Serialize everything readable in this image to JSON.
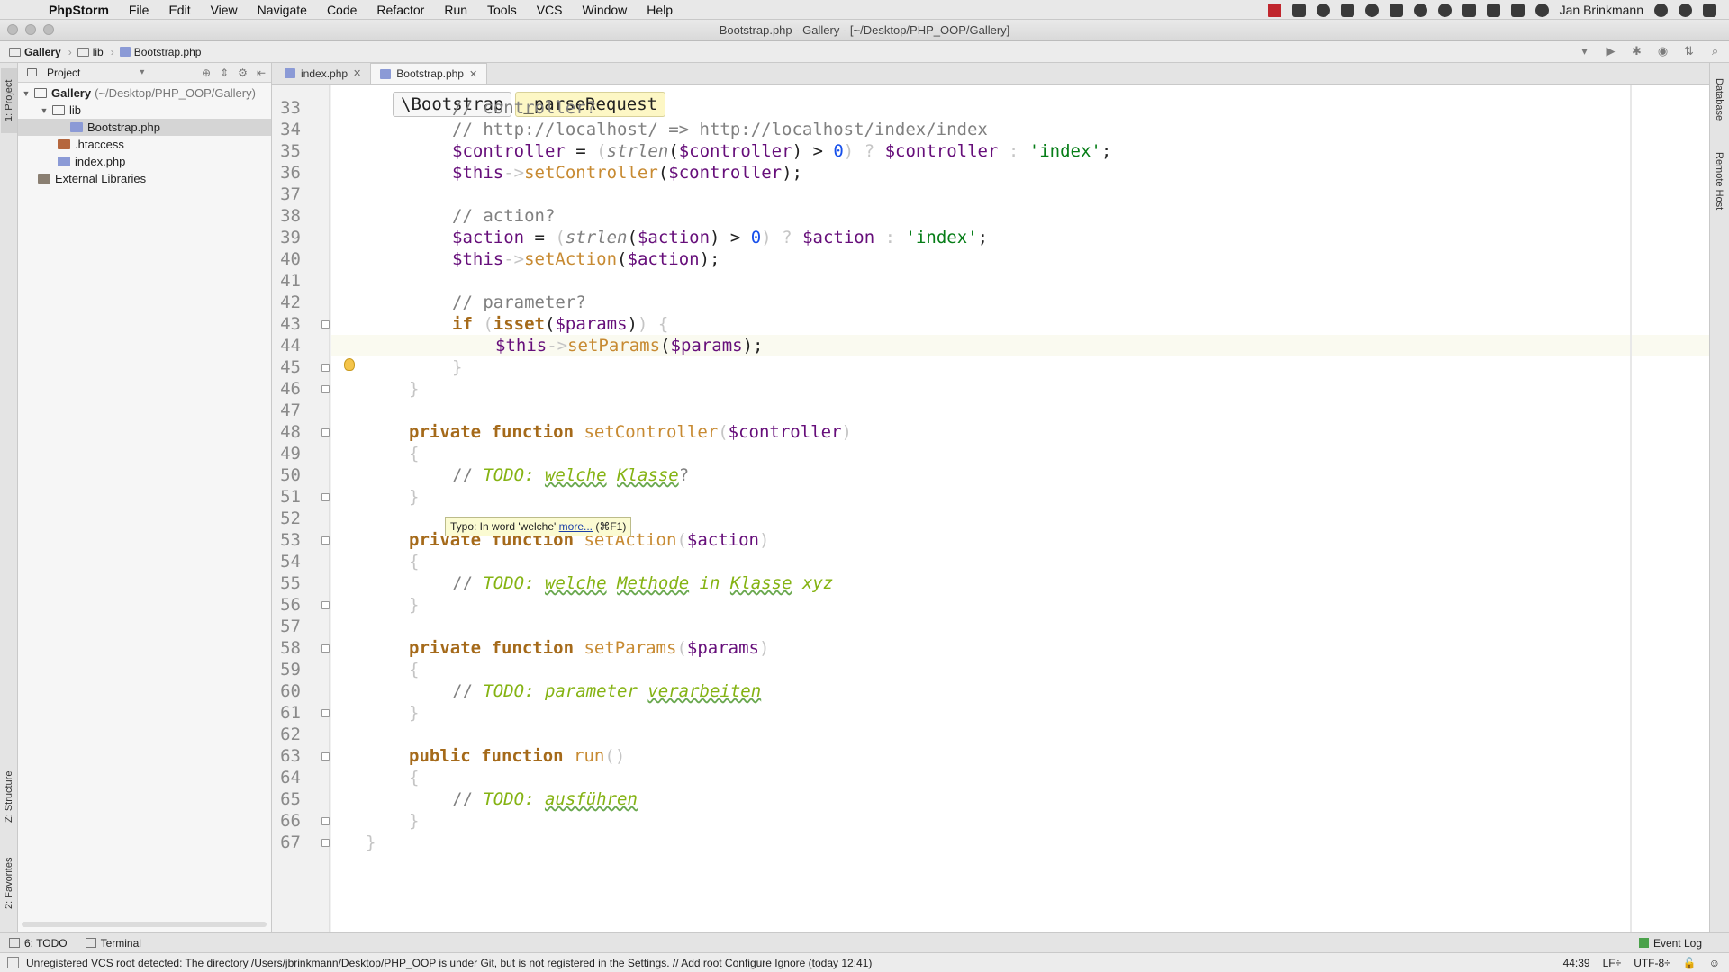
{
  "menubar": {
    "items": [
      "PhpStorm",
      "File",
      "Edit",
      "View",
      "Navigate",
      "Code",
      "Refactor",
      "Run",
      "Tools",
      "VCS",
      "Window",
      "Help"
    ],
    "user": "Jan Brinkmann"
  },
  "window": {
    "title": "Bootstrap.php - Gallery - [~/Desktop/PHP_OOP/Gallery]"
  },
  "navbar": {
    "crumbs": [
      "Gallery",
      "lib",
      "Bootstrap.php"
    ]
  },
  "project": {
    "header": "Project",
    "tree": [
      {
        "label": "Gallery",
        "path": "(~/Desktop/PHP_OOP/Gallery)",
        "type": "folder",
        "depth": 0,
        "expanded": true
      },
      {
        "label": "lib",
        "type": "folder",
        "depth": 1,
        "expanded": true
      },
      {
        "label": "Bootstrap.php",
        "type": "php",
        "depth": 2,
        "selected": true
      },
      {
        "label": ".htaccess",
        "type": "htaccess",
        "depth": 1
      },
      {
        "label": "index.php",
        "type": "php",
        "depth": 1
      },
      {
        "label": "External Libraries",
        "type": "lib",
        "depth": 0
      }
    ]
  },
  "side_tabs": {
    "project": "1: Project",
    "structure": "Z: Structure",
    "favorites": "2: Favorites",
    "database": "Database",
    "remote": "Remote Host"
  },
  "tabs": [
    {
      "label": "index.php",
      "active": false
    },
    {
      "label": "Bootstrap.php",
      "active": true
    }
  ],
  "editor": {
    "breadcrumb": [
      "\\Bootstrap",
      "_parseRequest"
    ],
    "line_numbers": [
      "33",
      "34",
      "35",
      "36",
      "37",
      "38",
      "39",
      "40",
      "41",
      "42",
      "43",
      "44",
      "45",
      "46",
      "47",
      "48",
      "49",
      "50",
      "51",
      "52",
      "53",
      "54",
      "55",
      "56",
      "57",
      "58",
      "59",
      "60",
      "61",
      "62",
      "63",
      "64",
      "65",
      "66",
      "67"
    ],
    "tooltip": {
      "text": "Typo: In word 'welche'",
      "link": "more...",
      "shortcut": "(⌘F1)"
    }
  },
  "bottom_tools": {
    "todo": "6: TODO",
    "terminal": "Terminal",
    "event_log": "Event Log"
  },
  "status": {
    "message": "Unregistered VCS root detected: The directory /Users/jbrinkmann/Desktop/PHP_OOP is under Git, but is not registered in the Settings. // Add root  Configure  Ignore (today 12:41)",
    "position": "44:39",
    "line_sep": "LF÷",
    "encoding": "UTF-8÷"
  }
}
